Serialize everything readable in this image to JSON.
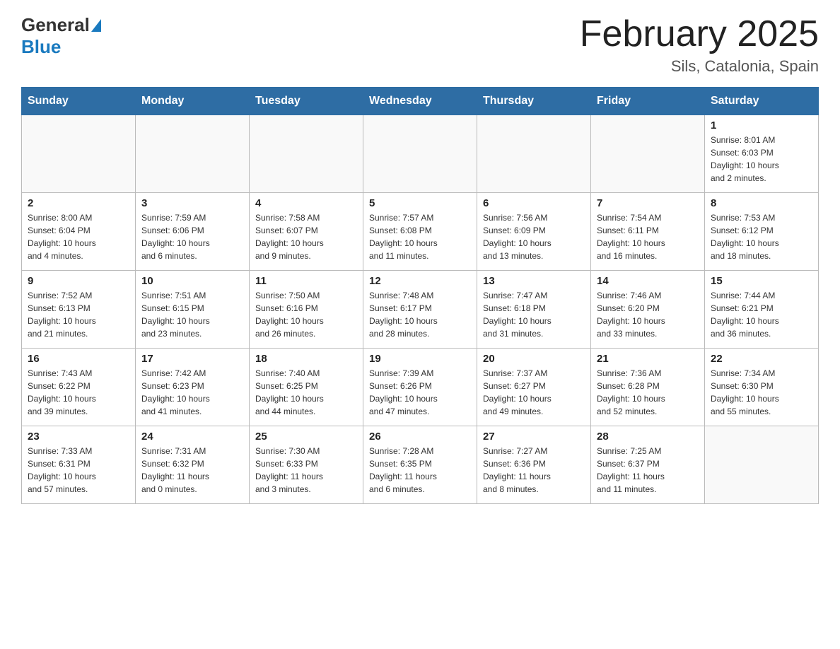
{
  "header": {
    "logo_general": "General",
    "logo_blue": "Blue",
    "month_title": "February 2025",
    "location": "Sils, Catalonia, Spain"
  },
  "weekdays": [
    "Sunday",
    "Monday",
    "Tuesday",
    "Wednesday",
    "Thursday",
    "Friday",
    "Saturday"
  ],
  "weeks": [
    [
      {
        "day": "",
        "info": ""
      },
      {
        "day": "",
        "info": ""
      },
      {
        "day": "",
        "info": ""
      },
      {
        "day": "",
        "info": ""
      },
      {
        "day": "",
        "info": ""
      },
      {
        "day": "",
        "info": ""
      },
      {
        "day": "1",
        "info": "Sunrise: 8:01 AM\nSunset: 6:03 PM\nDaylight: 10 hours\nand 2 minutes."
      }
    ],
    [
      {
        "day": "2",
        "info": "Sunrise: 8:00 AM\nSunset: 6:04 PM\nDaylight: 10 hours\nand 4 minutes."
      },
      {
        "day": "3",
        "info": "Sunrise: 7:59 AM\nSunset: 6:06 PM\nDaylight: 10 hours\nand 6 minutes."
      },
      {
        "day": "4",
        "info": "Sunrise: 7:58 AM\nSunset: 6:07 PM\nDaylight: 10 hours\nand 9 minutes."
      },
      {
        "day": "5",
        "info": "Sunrise: 7:57 AM\nSunset: 6:08 PM\nDaylight: 10 hours\nand 11 minutes."
      },
      {
        "day": "6",
        "info": "Sunrise: 7:56 AM\nSunset: 6:09 PM\nDaylight: 10 hours\nand 13 minutes."
      },
      {
        "day": "7",
        "info": "Sunrise: 7:54 AM\nSunset: 6:11 PM\nDaylight: 10 hours\nand 16 minutes."
      },
      {
        "day": "8",
        "info": "Sunrise: 7:53 AM\nSunset: 6:12 PM\nDaylight: 10 hours\nand 18 minutes."
      }
    ],
    [
      {
        "day": "9",
        "info": "Sunrise: 7:52 AM\nSunset: 6:13 PM\nDaylight: 10 hours\nand 21 minutes."
      },
      {
        "day": "10",
        "info": "Sunrise: 7:51 AM\nSunset: 6:15 PM\nDaylight: 10 hours\nand 23 minutes."
      },
      {
        "day": "11",
        "info": "Sunrise: 7:50 AM\nSunset: 6:16 PM\nDaylight: 10 hours\nand 26 minutes."
      },
      {
        "day": "12",
        "info": "Sunrise: 7:48 AM\nSunset: 6:17 PM\nDaylight: 10 hours\nand 28 minutes."
      },
      {
        "day": "13",
        "info": "Sunrise: 7:47 AM\nSunset: 6:18 PM\nDaylight: 10 hours\nand 31 minutes."
      },
      {
        "day": "14",
        "info": "Sunrise: 7:46 AM\nSunset: 6:20 PM\nDaylight: 10 hours\nand 33 minutes."
      },
      {
        "day": "15",
        "info": "Sunrise: 7:44 AM\nSunset: 6:21 PM\nDaylight: 10 hours\nand 36 minutes."
      }
    ],
    [
      {
        "day": "16",
        "info": "Sunrise: 7:43 AM\nSunset: 6:22 PM\nDaylight: 10 hours\nand 39 minutes."
      },
      {
        "day": "17",
        "info": "Sunrise: 7:42 AM\nSunset: 6:23 PM\nDaylight: 10 hours\nand 41 minutes."
      },
      {
        "day": "18",
        "info": "Sunrise: 7:40 AM\nSunset: 6:25 PM\nDaylight: 10 hours\nand 44 minutes."
      },
      {
        "day": "19",
        "info": "Sunrise: 7:39 AM\nSunset: 6:26 PM\nDaylight: 10 hours\nand 47 minutes."
      },
      {
        "day": "20",
        "info": "Sunrise: 7:37 AM\nSunset: 6:27 PM\nDaylight: 10 hours\nand 49 minutes."
      },
      {
        "day": "21",
        "info": "Sunrise: 7:36 AM\nSunset: 6:28 PM\nDaylight: 10 hours\nand 52 minutes."
      },
      {
        "day": "22",
        "info": "Sunrise: 7:34 AM\nSunset: 6:30 PM\nDaylight: 10 hours\nand 55 minutes."
      }
    ],
    [
      {
        "day": "23",
        "info": "Sunrise: 7:33 AM\nSunset: 6:31 PM\nDaylight: 10 hours\nand 57 minutes."
      },
      {
        "day": "24",
        "info": "Sunrise: 7:31 AM\nSunset: 6:32 PM\nDaylight: 11 hours\nand 0 minutes."
      },
      {
        "day": "25",
        "info": "Sunrise: 7:30 AM\nSunset: 6:33 PM\nDaylight: 11 hours\nand 3 minutes."
      },
      {
        "day": "26",
        "info": "Sunrise: 7:28 AM\nSunset: 6:35 PM\nDaylight: 11 hours\nand 6 minutes."
      },
      {
        "day": "27",
        "info": "Sunrise: 7:27 AM\nSunset: 6:36 PM\nDaylight: 11 hours\nand 8 minutes."
      },
      {
        "day": "28",
        "info": "Sunrise: 7:25 AM\nSunset: 6:37 PM\nDaylight: 11 hours\nand 11 minutes."
      },
      {
        "day": "",
        "info": ""
      }
    ]
  ]
}
